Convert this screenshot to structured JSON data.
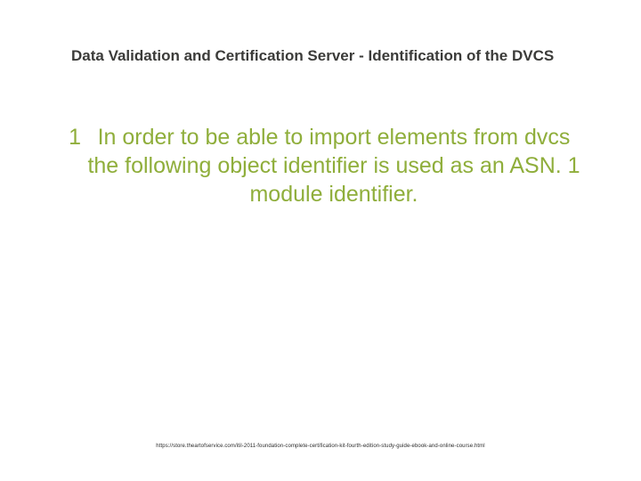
{
  "slide": {
    "title": "Data Validation and Certification Server - Identification of the DVCS",
    "bullet_number": "1",
    "body": "In order to be able to import elements from dvcs the following object identifier is used as an ASN. 1 module identifier.",
    "footer_url": "https://store.theartofservice.com/itil-2011-foundation-complete-certification-kit-fourth-edition-study-guide-ebook-and-online-course.html"
  }
}
